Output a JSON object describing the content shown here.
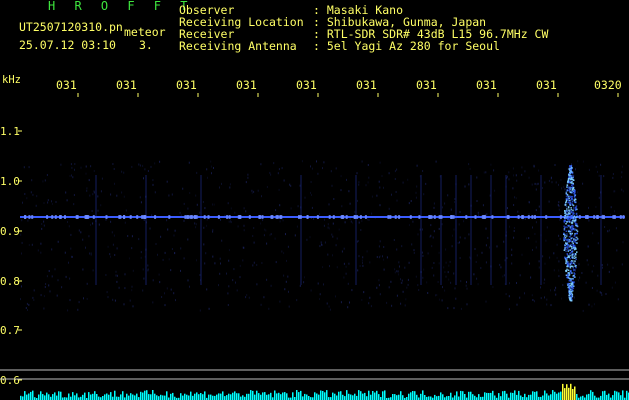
{
  "header": {
    "app_title": "H R O F F T",
    "filename": "UT2507120310.pn",
    "meteor_label": "meteor",
    "datetime": "25.07.12 03:10",
    "count": "3."
  },
  "meta": [
    {
      "label": "Observer",
      "value": ": Masaki Kano"
    },
    {
      "label": "Receiving Location",
      "value": ": Shibukawa, Gunma, Japan"
    },
    {
      "label": "Receiver",
      "value": ": RTL-SDR SDR# 43dB L15 96.7MHz CW"
    },
    {
      "label": "Receiving Antenna",
      "value": ": 5el Yagi Az 280 for Seoul"
    }
  ],
  "spectrogram": {
    "y_unit": "kHz",
    "y_ticks": [
      "1.1",
      "1.0",
      "0.9",
      "0.8",
      "0.7",
      "0.6"
    ],
    "x_ticks": [
      "031",
      "031",
      "031",
      "031",
      "031",
      "031",
      "031",
      "031",
      "031",
      "0320"
    ],
    "colors": {
      "background": "#000000",
      "text": "#ffff66",
      "title": "#3ee63e",
      "carrier": "#3a5cff",
      "echo": "#7fd0ff",
      "level": "#00ffff"
    }
  }
}
